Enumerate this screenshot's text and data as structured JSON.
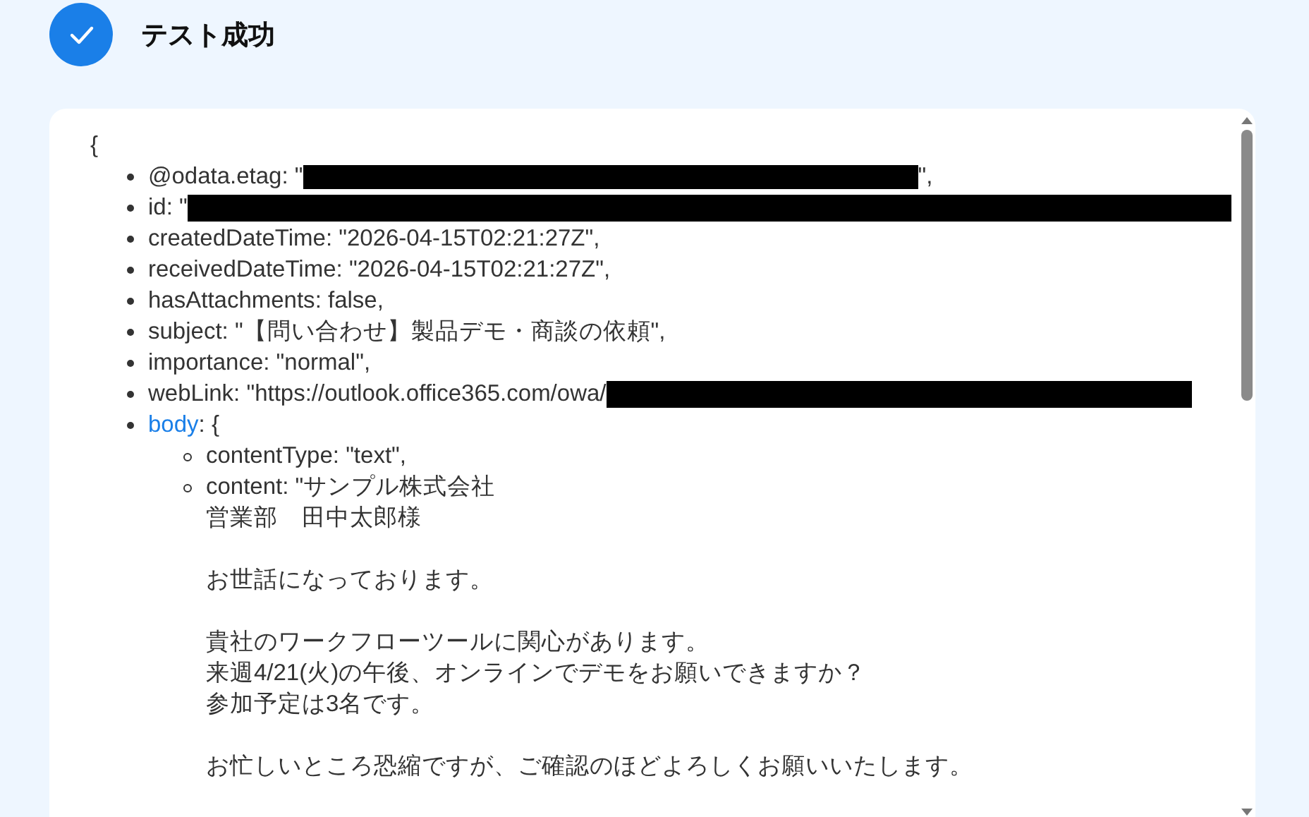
{
  "header": {
    "title": "テスト成功"
  },
  "result": {
    "open_brace": "{",
    "fields": [
      {
        "key": "@odata.etag",
        "rest": ": \"",
        "redacted": true,
        "after": "\","
      },
      {
        "key": "id",
        "rest": ": \"",
        "redacted": true
      },
      {
        "key": "createdDateTime",
        "rest": ": \"2026-04-15T02:21:27Z\","
      },
      {
        "key": "receivedDateTime",
        "rest": ": \"2026-04-15T02:21:27Z\","
      },
      {
        "key": "hasAttachments",
        "rest": ": false,"
      },
      {
        "key": "subject",
        "rest": ": \"【問い合わせ】製品デモ・商談の依頼\","
      },
      {
        "key": "importance",
        "rest": ": \"normal\","
      },
      {
        "key": "webLink",
        "rest": ": \"https://outlook.office365.com/owa/",
        "redacted": true
      },
      {
        "key": "body",
        "link": true,
        "rest": ": {",
        "children": [
          {
            "key": "contentType",
            "rest": ": \"text\","
          },
          {
            "key": "content",
            "rest": ": \"",
            "paragraphs": [
              [
                "サンプル株式会社",
                "営業部　田中太郎様"
              ],
              [
                "お世話になっております。"
              ],
              [
                "貴社のワークフローツールに関心があります。",
                "来週4/21(火)の午後、オンラインでデモをお願いできますか？",
                "参加予定は3名です。"
              ],
              [
                "お忙しいところ恐縮ですが、ご確認のほどよろしくお願いいたします。"
              ]
            ]
          }
        ]
      }
    ]
  }
}
